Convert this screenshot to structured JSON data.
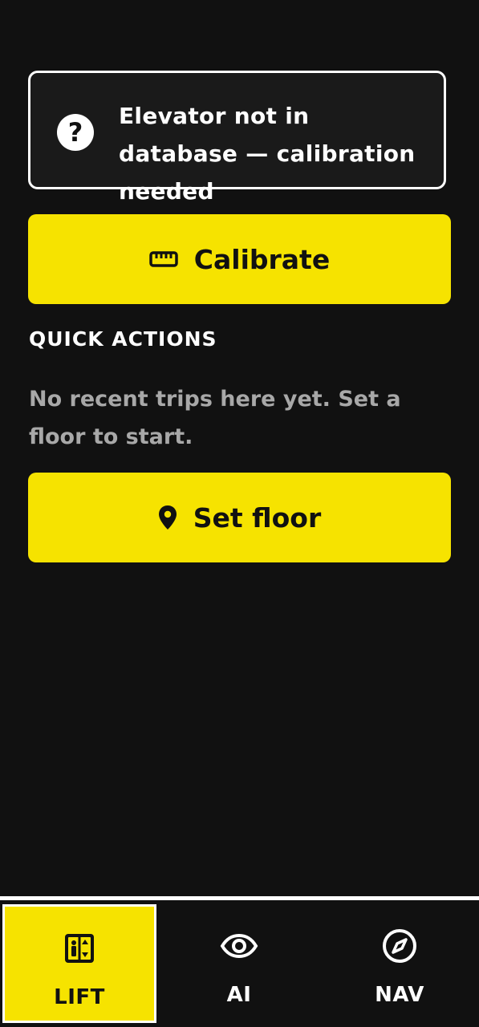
{
  "status_card": {
    "icon": "question-circle-icon",
    "message": "Elevator not in database — calibration needed"
  },
  "calibrate_button": {
    "icon": "ruler-icon",
    "label": "Calibrate"
  },
  "quick_actions": {
    "heading": "QUICK ACTIONS",
    "empty_message": "No recent trips here yet. Set a floor to start."
  },
  "set_floor_button": {
    "icon": "map-pin-icon",
    "label": "Set floor"
  },
  "bottom_nav": {
    "tabs": [
      {
        "label": "LIFT",
        "icon": "elevator-icon",
        "active": true
      },
      {
        "label": "AI",
        "icon": "eye-icon",
        "active": false
      },
      {
        "label": "NAV",
        "icon": "compass-icon",
        "active": false
      }
    ]
  },
  "colors": {
    "background": "#111111",
    "accent": "#f6e300",
    "text_primary": "#ffffff",
    "text_muted": "#a8a8a8"
  }
}
